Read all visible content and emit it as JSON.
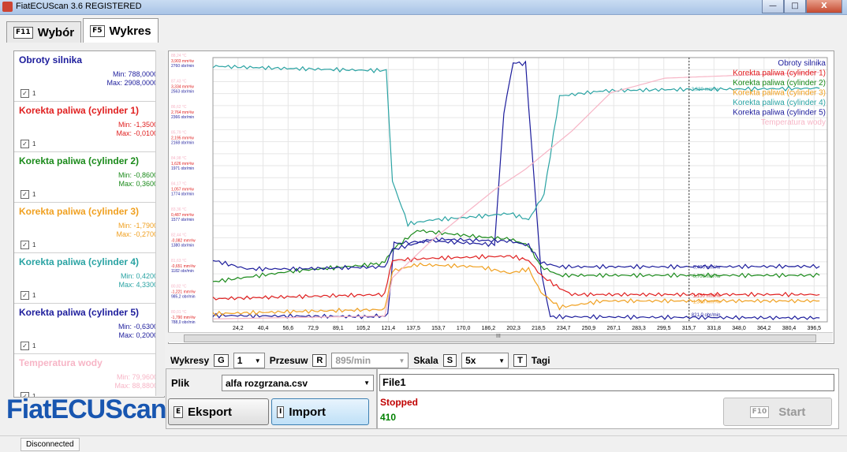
{
  "window": {
    "title": "FiatECUScan 3.6 REGISTERED",
    "minimize": "—",
    "maximize": "□",
    "close": "X"
  },
  "tabs": [
    {
      "key": "F11",
      "label": "Wybór"
    },
    {
      "key": "F5",
      "label": "Wykres"
    }
  ],
  "params": [
    {
      "name": "Obroty silnika",
      "min": "Min: 788,0000",
      "max": "Max: 2908,0000",
      "check": "1",
      "color": "#1d1d9c"
    },
    {
      "name": "Korekta paliwa (cylinder 1)",
      "min": "Min: -1,3500",
      "max": "Max: -0,0100",
      "check": "1",
      "color": "#e02020"
    },
    {
      "name": "Korekta paliwa (cylinder 2)",
      "min": "Min: -0,8600",
      "max": "Max: 0,3600",
      "check": "1",
      "color": "#1a8a1a"
    },
    {
      "name": "Korekta paliwa (cylinder 3)",
      "min": "Min: -1,7900",
      "max": "Max: -0,2700",
      "check": "1",
      "color": "#f0a020"
    },
    {
      "name": "Korekta paliwa (cylinder 4)",
      "min": "Min: 0,4200",
      "max": "Max: 4,3300",
      "check": "1",
      "color": "#2aa3a3"
    },
    {
      "name": "Korekta paliwa (cylinder 5)",
      "min": "Min: -0,6300",
      "max": "Max: 0,2000",
      "check": "1",
      "color": "#1d1d9c"
    },
    {
      "name": "Temperatura wody",
      "min": "Min: 79,9600",
      "max": "Max: 88,8800",
      "check": "1",
      "color": "#f7b5c6"
    }
  ],
  "logo": "FiatECUScan",
  "controls": {
    "wykresy_label": "Wykresy",
    "wykresy_key": "G",
    "wykresy_value": "1",
    "przesuw_label": "Przesuw",
    "przesuw_key": "R",
    "przesuw_value": "895/min",
    "skala_label": "Skala",
    "skala_key": "S",
    "skala_value": "5x",
    "tagi_key": "T",
    "tagi_label": "Tagi",
    "scroll_mark": "III"
  },
  "file": {
    "label": "Plik",
    "selected": "alfa rozgrzana.csv",
    "export_key": "E",
    "export_label": "Eksport",
    "import_key": "I",
    "import_label": "Import",
    "name": "File1",
    "status": "Stopped",
    "count": "410",
    "start_key": "F10",
    "start_label": "Start"
  },
  "statusbar": {
    "connection": "Disconnected"
  },
  "chart_data": {
    "type": "line",
    "x_ticks": [
      "24,2",
      "40,4",
      "56,6",
      "72,9",
      "89,1",
      "105,2",
      "121,4",
      "137,5",
      "153,7",
      "170,0",
      "186,2",
      "202,3",
      "218,5",
      "234,7",
      "250,9",
      "267,1",
      "283,3",
      "299,5",
      "315,7",
      "331,8",
      "348,0",
      "364,2",
      "380,4",
      "396,5"
    ],
    "y_ticks_fuel": [
      "3,903 mm³/w",
      "3,334 mm³/w",
      "2,764 mm³/w",
      "2,195 mm³/w",
      "1,626 mm³/w",
      "1,057 mm³/w",
      "0,487 mm³/w",
      "-0,082 mm³/w",
      "-0,651 mm³/w",
      "-1,221 mm³/w",
      "-1,790 mm³/w"
    ],
    "y_ticks_rpm": [
      "2760 obr/min",
      "2563 obr/min",
      "2366 obr/min",
      "2168 obr/min",
      "1971 obr/min",
      "1774 obr/min",
      "1577 obr/min",
      "1380 obr/min",
      "1182 obr/min",
      "985,2 obr/min",
      "788,0 obr/min"
    ],
    "y_ticks_temp": [
      "88,24 °C",
      "87,43 °C",
      "86,62 °C",
      "85,79 °C",
      "84,98 °C",
      "84,17 °C",
      "83,36 °C",
      "82,44 °C",
      "81,63 °C",
      "80,82 °C",
      "80,01 °C"
    ],
    "cursor_x": 315.7,
    "cursor_labels": [
      {
        "text": "3,680 mm³/w",
        "series": "Korekta paliwa (cylinder 4)"
      },
      {
        "text": "-0,490 mm³/w",
        "series": "Korekta paliwa (cylinder 5)"
      },
      {
        "text": "-0,700 mm³/w",
        "series": "Korekta paliwa (cylinder 2)"
      },
      {
        "text": "-1,150 mm³/w",
        "series": "Korekta paliwa (cylinder 1)"
      },
      {
        "text": "-1,300 mm³/w",
        "series": "Korekta paliwa (cylinder 3)"
      },
      {
        "text": "821,0 obr/min",
        "series": "Obroty silnika"
      }
    ],
    "legend_position": "top-right",
    "grid": true,
    "series": [
      {
        "name": "Obroty silnika",
        "color": "#1d1d9c",
        "fuel_axis": false,
        "points": [
          [
            8,
            840
          ],
          [
            110,
            830
          ],
          [
            121,
            840
          ],
          [
            125,
            1430
          ],
          [
            150,
            1450
          ],
          [
            190,
            1420
          ],
          [
            196,
            2500
          ],
          [
            202,
            2908
          ],
          [
            210,
            2900
          ],
          [
            220,
            1200
          ],
          [
            226,
            830
          ],
          [
            300,
            825
          ],
          [
            400,
            820
          ]
        ]
      },
      {
        "name": "Korekta paliwa (cylinder 1)",
        "color": "#e02020",
        "fuel_axis": true,
        "points": [
          [
            8,
            -1.25
          ],
          [
            60,
            -1.2
          ],
          [
            119,
            -1.15
          ],
          [
            124,
            -0.35
          ],
          [
            150,
            -0.3
          ],
          [
            200,
            -0.25
          ],
          [
            212,
            -0.35
          ],
          [
            220,
            -0.7
          ],
          [
            232,
            -1.0
          ],
          [
            240,
            -1.15
          ],
          [
            300,
            -1.15
          ],
          [
            400,
            -1.15
          ]
        ]
      },
      {
        "name": "Korekta paliwa (cylinder 2)",
        "color": "#1a8a1a",
        "fuel_axis": true,
        "points": [
          [
            8,
            -0.85
          ],
          [
            60,
            -0.6
          ],
          [
            110,
            -0.45
          ],
          [
            119,
            -0.4
          ],
          [
            124,
            -0.1
          ],
          [
            140,
            0.35
          ],
          [
            180,
            0.2
          ],
          [
            200,
            0.15
          ],
          [
            212,
            0.0
          ],
          [
            220,
            -0.5
          ],
          [
            232,
            -0.7
          ],
          [
            300,
            -0.7
          ],
          [
            400,
            -0.7
          ]
        ]
      },
      {
        "name": "Korekta paliwa (cylinder 3)",
        "color": "#f0a020",
        "fuel_axis": true,
        "points": [
          [
            8,
            -1.6
          ],
          [
            60,
            -1.55
          ],
          [
            119,
            -1.5
          ],
          [
            124,
            -0.6
          ],
          [
            140,
            -0.45
          ],
          [
            180,
            -0.5
          ],
          [
            200,
            -0.65
          ],
          [
            212,
            -0.55
          ],
          [
            220,
            -1.1
          ],
          [
            232,
            -1.45
          ],
          [
            260,
            -1.3
          ],
          [
            300,
            -1.3
          ],
          [
            400,
            -1.3
          ]
        ]
      },
      {
        "name": "Korekta paliwa (cylinder 4)",
        "color": "#2aa3a3",
        "fuel_axis": true,
        "points": [
          [
            8,
            4.2
          ],
          [
            50,
            4.15
          ],
          [
            110,
            4.1
          ],
          [
            120,
            4.1
          ],
          [
            124,
            1.5
          ],
          [
            134,
            0.5
          ],
          [
            150,
            0.6
          ],
          [
            170,
            0.65
          ],
          [
            200,
            0.75
          ],
          [
            212,
            0.6
          ],
          [
            222,
            1.2
          ],
          [
            232,
            3.5
          ],
          [
            260,
            3.62
          ],
          [
            300,
            3.65
          ],
          [
            400,
            3.68
          ]
        ]
      },
      {
        "name": "Korekta paliwa (cylinder 5)",
        "color": "#1d1d9c",
        "fuel_axis": true,
        "points": [
          [
            8,
            -0.35
          ],
          [
            30,
            -0.55
          ],
          [
            60,
            -0.55
          ],
          [
            119,
            -0.5
          ],
          [
            124,
            -0.1
          ],
          [
            150,
            0.15
          ],
          [
            200,
            0.1
          ],
          [
            212,
            0.0
          ],
          [
            220,
            -0.4
          ],
          [
            232,
            -0.5
          ],
          [
            300,
            -0.5
          ],
          [
            400,
            -0.49
          ]
        ]
      },
      {
        "name": "Temperatura wody",
        "color": "#f7b5c6",
        "fuel_axis": false,
        "temp": true,
        "points": [
          [
            8,
            80.1
          ],
          [
            119,
            80.2
          ],
          [
            124,
            81.5
          ],
          [
            150,
            82.8
          ],
          [
            190,
            84.5
          ],
          [
            210,
            85.2
          ],
          [
            240,
            86.5
          ],
          [
            265,
            87.8
          ],
          [
            300,
            88.3
          ],
          [
            400,
            88.5
          ]
        ]
      }
    ]
  }
}
